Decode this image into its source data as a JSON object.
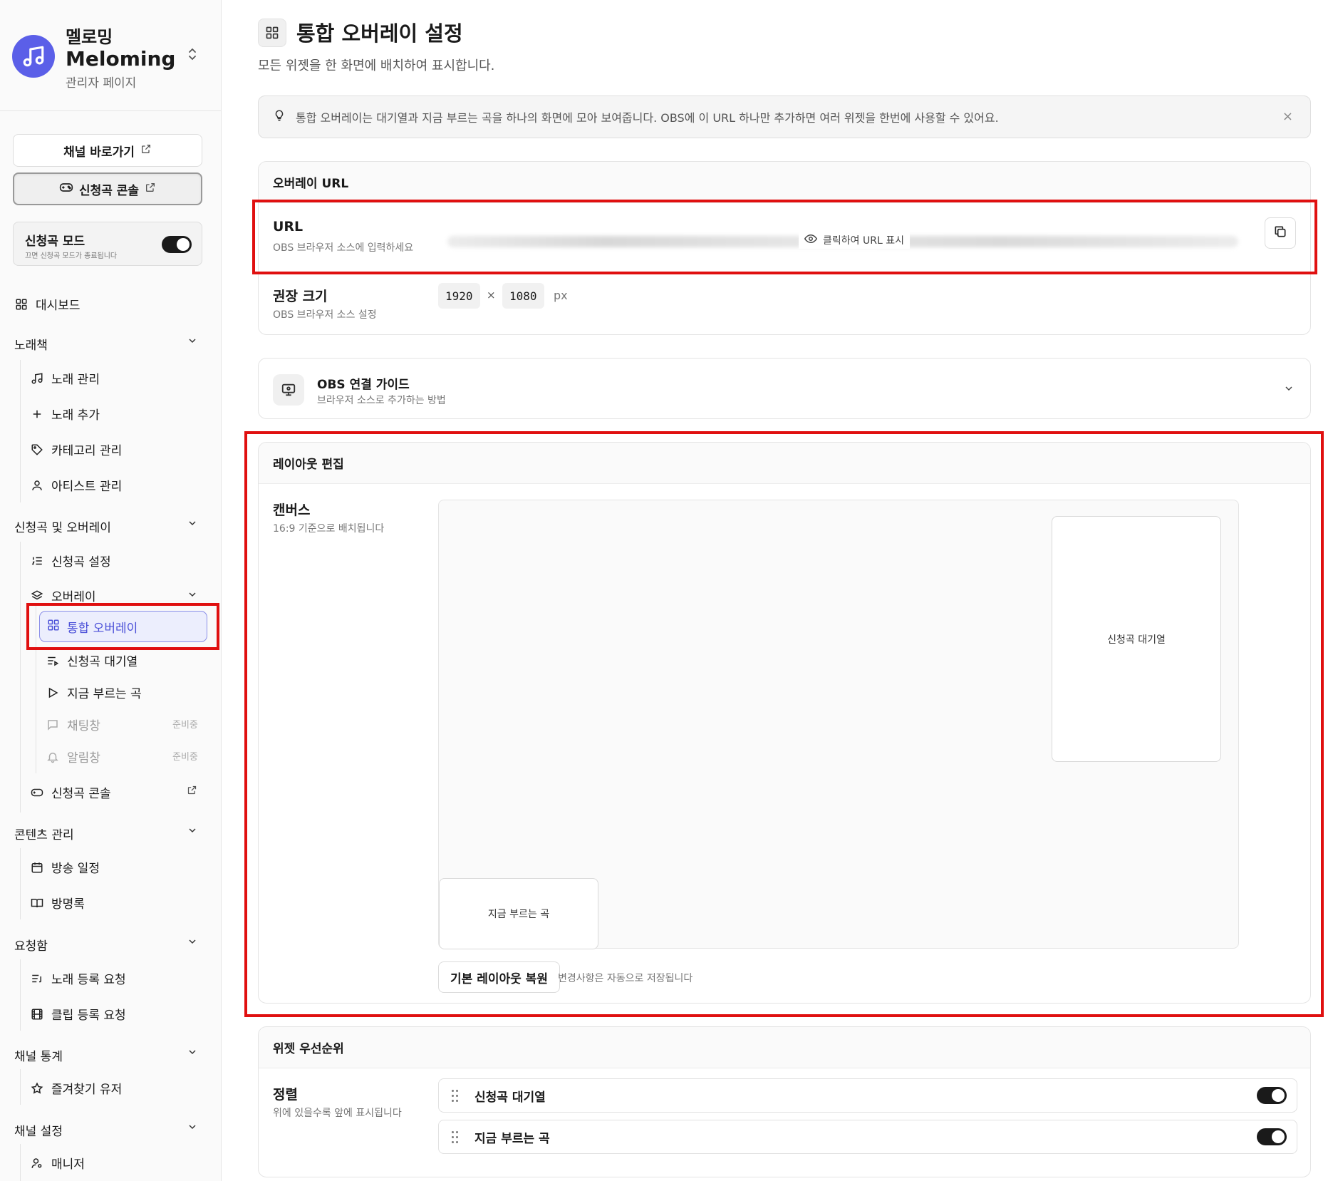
{
  "brand": {
    "name_kr": "멜로밍",
    "name_en": "Meloming",
    "subtitle": "관리자 페이지"
  },
  "sidebar": {
    "channel_link": "채널 바로가기",
    "console_button": "신청곡 콘솔",
    "request_mode": {
      "title": "신청곡 모드",
      "desc": "끄면 신청곡 모드가 종료됩니다",
      "enabled": true
    },
    "dashboard": "대시보드",
    "sections": {
      "songbook": {
        "title": "노래책",
        "items": [
          "노래 관리",
          "노래 추가",
          "카테고리 관리",
          "아티스트 관리"
        ]
      },
      "requests": {
        "title": "신청곡 및 오버레이",
        "settings": "신청곡 설정",
        "overlay": "오버레이",
        "overlay_items": {
          "integrated": "통합 오버레이",
          "queue": "신청곡 대기열",
          "now_playing": "지금 부르는 곡",
          "chat": "채팅창",
          "alert": "알림창"
        },
        "soon_label": "준비중",
        "console": "신청곡 콘솔"
      },
      "content": {
        "title": "콘텐츠 관리",
        "items": [
          "방송 일정",
          "방명록"
        ]
      },
      "inbox": {
        "title": "요청함",
        "items": [
          "노래 등록 요청",
          "클립 등록 요청"
        ]
      },
      "stats": {
        "title": "채널 통계",
        "items": [
          "즐겨찾기 유저"
        ]
      },
      "settings": {
        "title": "채널 설정",
        "items": [
          "매니저"
        ]
      }
    }
  },
  "page": {
    "title": "통합 오버레이 설정",
    "description": "모든 위젯을 한 화면에 배치하여 표시합니다.",
    "tip": "통합 오버레이는 대기열과 지금 부르는 곡을 하나의 화면에 모아 보여줍니다. OBS에 이 URL 하나만 추가하면 여러 위젯을 한번에 사용할 수 있어요.",
    "tip_close": "×"
  },
  "overlay_url": {
    "heading": "오버레이 URL",
    "url_label": "URL",
    "url_sub": "OBS 브라우저 소스에 입력하세요",
    "reveal_text": "클릭하여 URL 표시",
    "size_label": "권장 크기",
    "size_sub": "OBS 브라우저 소스 설정",
    "width": "1920",
    "times": "×",
    "height": "1080",
    "unit": "px"
  },
  "obs_guide": {
    "title": "OBS 연결 가이드",
    "subtitle": "브라우저 소스로 추가하는 방법"
  },
  "layout_editor": {
    "heading": "레이아웃 편집",
    "canvas_label": "캔버스",
    "canvas_sub": "16:9 기준으로 배치됩니다",
    "widgets": [
      "신청곡 대기열",
      "지금 부르는 곡"
    ],
    "reset_button": "기본 레이아웃 복원",
    "autosave_note": "변경사항은 자동으로 저장됩니다"
  },
  "widget_priority": {
    "heading": "위젯 우선순위",
    "sort_label": "정렬",
    "sort_sub": "위에 있을수록 앞에 표시됩니다",
    "rows": [
      {
        "label": "신청곡 대기열",
        "enabled": true
      },
      {
        "label": "지금 부르는 곡",
        "enabled": true
      }
    ]
  },
  "colors": {
    "accent": "#5b5fe8",
    "active_text": "#4b50d8",
    "highlight_red": "#e01010"
  }
}
